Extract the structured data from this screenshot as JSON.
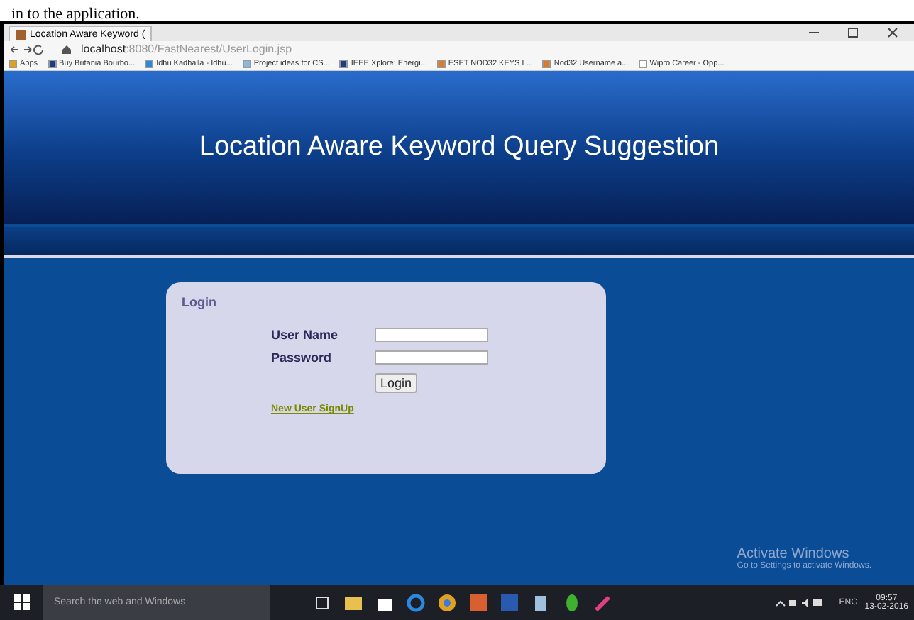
{
  "caption": "in to the application.",
  "browser": {
    "tab_title": "Location Aware Keyword (",
    "url_host": "localhost",
    "url_path": ":8080/FastNearest/UserLogin.jsp",
    "bookmarks": [
      {
        "label": "Apps",
        "color": "#e0a020"
      },
      {
        "label": "Buy Britania Bourbo...",
        "color": "#1a3d8a"
      },
      {
        "label": "Idhu Kadhalla - Idhu...",
        "color": "#2a8ad8"
      },
      {
        "label": "Project ideas for CS...",
        "color": "#8ab8e0"
      },
      {
        "label": "IEEE Xplore: Energi...",
        "color": "#1a3d8a"
      },
      {
        "label": "ESET NOD32 KEYS L...",
        "color": "#e07a20"
      },
      {
        "label": "Nod32 Username a...",
        "color": "#e07a20"
      },
      {
        "label": "Wipro Career - Opp...",
        "color": "#ffffff"
      }
    ]
  },
  "page": {
    "title": "Location Aware Keyword Query Suggestion",
    "login": {
      "heading": "Login",
      "fields": [
        {
          "label": "User Name"
        },
        {
          "label": "Password"
        }
      ],
      "button": "Login",
      "signup_link": "New User SignUp"
    }
  },
  "activation_notice": {
    "title": "Activate Windows",
    "subtitle": "Go to Settings to activate Windows."
  },
  "taskbar": {
    "search_placeholder": "Search the web and Windows",
    "language": "ENG",
    "time": "09:57",
    "date": "13-02-2016"
  }
}
